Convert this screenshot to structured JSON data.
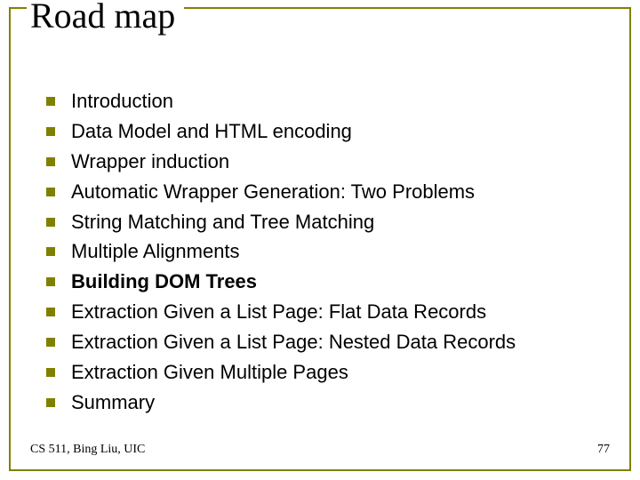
{
  "title": "Road map",
  "items": [
    {
      "text": "Introduction",
      "bold": false
    },
    {
      "text": "Data Model and HTML encoding",
      "bold": false
    },
    {
      "text": "Wrapper induction",
      "bold": false
    },
    {
      "text": "Automatic Wrapper Generation: Two Problems",
      "bold": false
    },
    {
      "text": "String Matching and Tree Matching",
      "bold": false
    },
    {
      "text": "Multiple Alignments",
      "bold": false
    },
    {
      "text": "Building DOM Trees",
      "bold": true
    },
    {
      "text": "Extraction Given a List Page: Flat Data Records",
      "bold": false
    },
    {
      "text": "Extraction Given a List Page: Nested Data Records",
      "bold": false
    },
    {
      "text": "Extraction Given Multiple Pages",
      "bold": false
    },
    {
      "text": "Summary",
      "bold": false
    }
  ],
  "footer": {
    "left": "CS 511, Bing Liu, UIC",
    "right": "77"
  }
}
